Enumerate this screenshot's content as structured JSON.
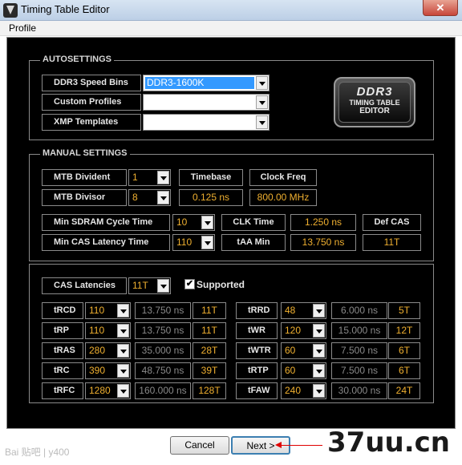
{
  "window": {
    "title": "Timing Table Editor",
    "close_glyph": "✕"
  },
  "menu": {
    "profile": "Profile"
  },
  "autosettings": {
    "title": "AUTOSETTINGS",
    "speed_bins_label": "DDR3 Speed Bins",
    "speed_bins_value": "DDR3-1600K",
    "custom_profiles_label": "Custom Profiles",
    "xmp_templates_label": "XMP Templates"
  },
  "logo": {
    "line1": "DDR3",
    "line2": "TIMING TABLE",
    "line3": "EDITOR"
  },
  "manual": {
    "title": "MANUAL SETTINGS",
    "mtb_divident_label": "MTB Divident",
    "mtb_divident_value": "1",
    "mtb_divisor_label": "MTB Divisor",
    "mtb_divisor_value": "8",
    "timebase_label": "Timebase",
    "timebase_value": "0.125 ns",
    "clockfreq_label": "Clock Freq",
    "clockfreq_value": "800.00 MHz",
    "min_sdram_label": "Min SDRAM Cycle Time",
    "min_sdram_value": "10",
    "min_cas_label": "Min CAS Latency Time",
    "min_cas_value": "110",
    "clk_time_label": "CLK Time",
    "clk_time_value": "1.250 ns",
    "taa_min_label": "tAA Min",
    "taa_min_value": "13.750 ns",
    "def_cas_label": "Def CAS",
    "def_cas_value": "11T"
  },
  "cas": {
    "label": "CAS Latencies",
    "value": "11T",
    "supported_label": "Supported",
    "supported_checked": "✔"
  },
  "timings_left": [
    {
      "name": "tRCD",
      "value": "110",
      "ns": "13.750 ns",
      "t": "11T"
    },
    {
      "name": "tRP",
      "value": "110",
      "ns": "13.750 ns",
      "t": "11T"
    },
    {
      "name": "tRAS",
      "value": "280",
      "ns": "35.000 ns",
      "t": "28T"
    },
    {
      "name": "tRC",
      "value": "390",
      "ns": "48.750 ns",
      "t": "39T"
    },
    {
      "name": "tRFC",
      "value": "1280",
      "ns": "160.000 ns",
      "t": "128T"
    }
  ],
  "timings_right": [
    {
      "name": "tRRD",
      "value": "48",
      "ns": "6.000 ns",
      "t": "5T"
    },
    {
      "name": "tWR",
      "value": "120",
      "ns": "15.000 ns",
      "t": "12T"
    },
    {
      "name": "tWTR",
      "value": "60",
      "ns": "7.500 ns",
      "t": "6T"
    },
    {
      "name": "tRTP",
      "value": "60",
      "ns": "7.500 ns",
      "t": "6T"
    },
    {
      "name": "tFAW",
      "value": "240",
      "ns": "30.000 ns",
      "t": "24T"
    }
  ],
  "buttons": {
    "cancel": "Cancel",
    "next": "Next >"
  },
  "watermark": {
    "text": "37uu.cn",
    "baidu": "Bai 贴吧 | y400"
  }
}
